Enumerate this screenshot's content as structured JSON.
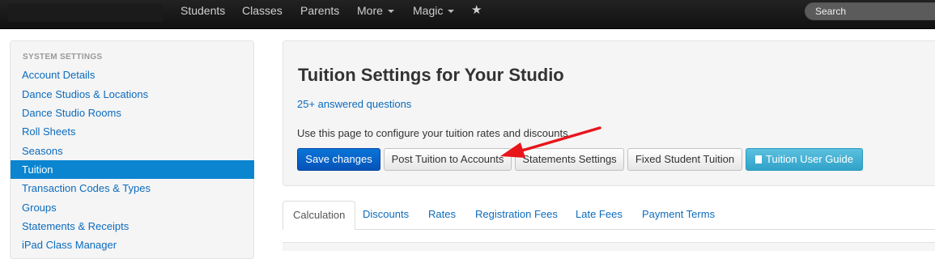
{
  "nav": {
    "items": [
      {
        "label": "Students"
      },
      {
        "label": "Classes"
      },
      {
        "label": "Parents"
      },
      {
        "label": "More"
      },
      {
        "label": "Magic"
      }
    ],
    "star_icon": "star-icon",
    "search_placeholder": "Search"
  },
  "sidebar": {
    "header": "SYSTEM SETTINGS",
    "items": [
      {
        "label": "Account Details"
      },
      {
        "label": "Dance Studios & Locations"
      },
      {
        "label": "Dance Studio Rooms"
      },
      {
        "label": "Roll Sheets"
      },
      {
        "label": "Seasons"
      },
      {
        "label": "Tuition",
        "active": true
      },
      {
        "label": "Transaction Codes & Types"
      },
      {
        "label": "Groups"
      },
      {
        "label": "Statements & Receipts"
      },
      {
        "label": "iPad Class Manager"
      }
    ]
  },
  "main": {
    "title": "Tuition Settings for Your Studio",
    "faq_link": "25+ answered questions",
    "description": "Use this page to configure your tuition rates and discounts.",
    "buttons": {
      "save": "Save changes",
      "post": "Post Tuition to Accounts",
      "statements": "Statements Settings",
      "fixed": "Fixed Student Tuition",
      "guide": "Tuition User Guide"
    },
    "tabs": [
      {
        "label": "Calculation",
        "active": true
      },
      {
        "label": "Discounts"
      },
      {
        "label": "Rates"
      },
      {
        "label": "Registration Fees"
      },
      {
        "label": "Late Fees"
      },
      {
        "label": "Payment Terms"
      }
    ]
  },
  "colors": {
    "accent": "#0b85d0",
    "link": "#0c6bbd",
    "primary_button": "#0a66cc",
    "info_button": "#5bc0de",
    "annotation_arrow": "#e8151b"
  }
}
